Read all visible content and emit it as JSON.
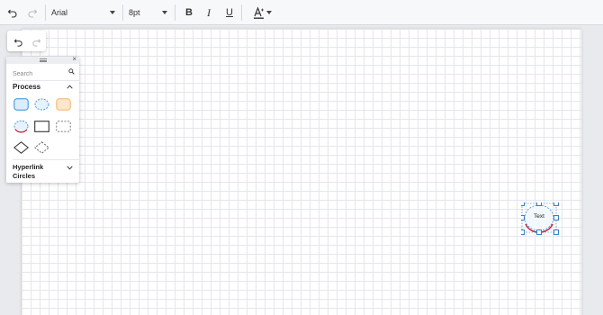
{
  "toolbar": {
    "undo_icon": "undo-icon",
    "redo_icon": "redo-icon",
    "font_family": "Arial",
    "font_size": "8pt",
    "bold_label": "B",
    "italic_label": "I",
    "underline_label": "U",
    "text_color_icon": "text-color-icon"
  },
  "floating": {
    "undo_icon": "undo-icon",
    "redo_icon": "redo-icon"
  },
  "panel": {
    "close_label": "×",
    "search_placeholder": "Search",
    "section_title": "Process",
    "shapes": [
      "rounded-rectangle-blue",
      "ellipse-dashed-blue",
      "rounded-rectangle-orange",
      "circle-dashed-blue-red",
      "rectangle",
      "rectangle-dashed",
      "diamond",
      "diamond-dashed"
    ],
    "collapsed_section": "Hyperlink Circles"
  },
  "canvas": {
    "selected_shape_text": "Text"
  },
  "colors": {
    "accent": "#1a73c9",
    "selection_handle": "#1f74c6",
    "shape_blue": "#a9d3f3",
    "shape_orange": "#f2b46b",
    "arc_red": "#c81d3a"
  }
}
